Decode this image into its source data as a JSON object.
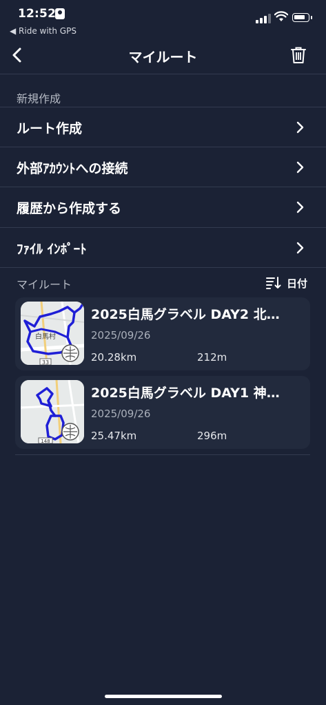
{
  "status_bar": {
    "time": "12:52",
    "back_app": "◀ Ride with GPS"
  },
  "nav": {
    "title": "マイルート"
  },
  "new_section": {
    "label": "新規作成",
    "items": [
      {
        "label": "ルート作成"
      },
      {
        "label": "外部ｱｶｳﾝﾄへの接続"
      },
      {
        "label": "履歴から作成する"
      },
      {
        "label": "ﾌｧｲﾙ ｲﾝﾎﾟｰﾄ"
      }
    ]
  },
  "my_routes": {
    "label": "マイルート",
    "sort_label": "日付",
    "routes": [
      {
        "title": "2025白馬グラベル DAY2 北…",
        "date": "2025/09/26",
        "distance": "20.28km",
        "elevation": "212m",
        "map_label": "白馬村",
        "road_number": "33"
      },
      {
        "title": "2025白馬グラベル DAY1 神…",
        "date": "2025/09/26",
        "distance": "25.47km",
        "elevation": "296m",
        "map_label": "",
        "road_number": "148"
      }
    ]
  },
  "colors": {
    "background": "#1b2235",
    "card": "#222a3d",
    "route_line": "#1f1fd6"
  }
}
